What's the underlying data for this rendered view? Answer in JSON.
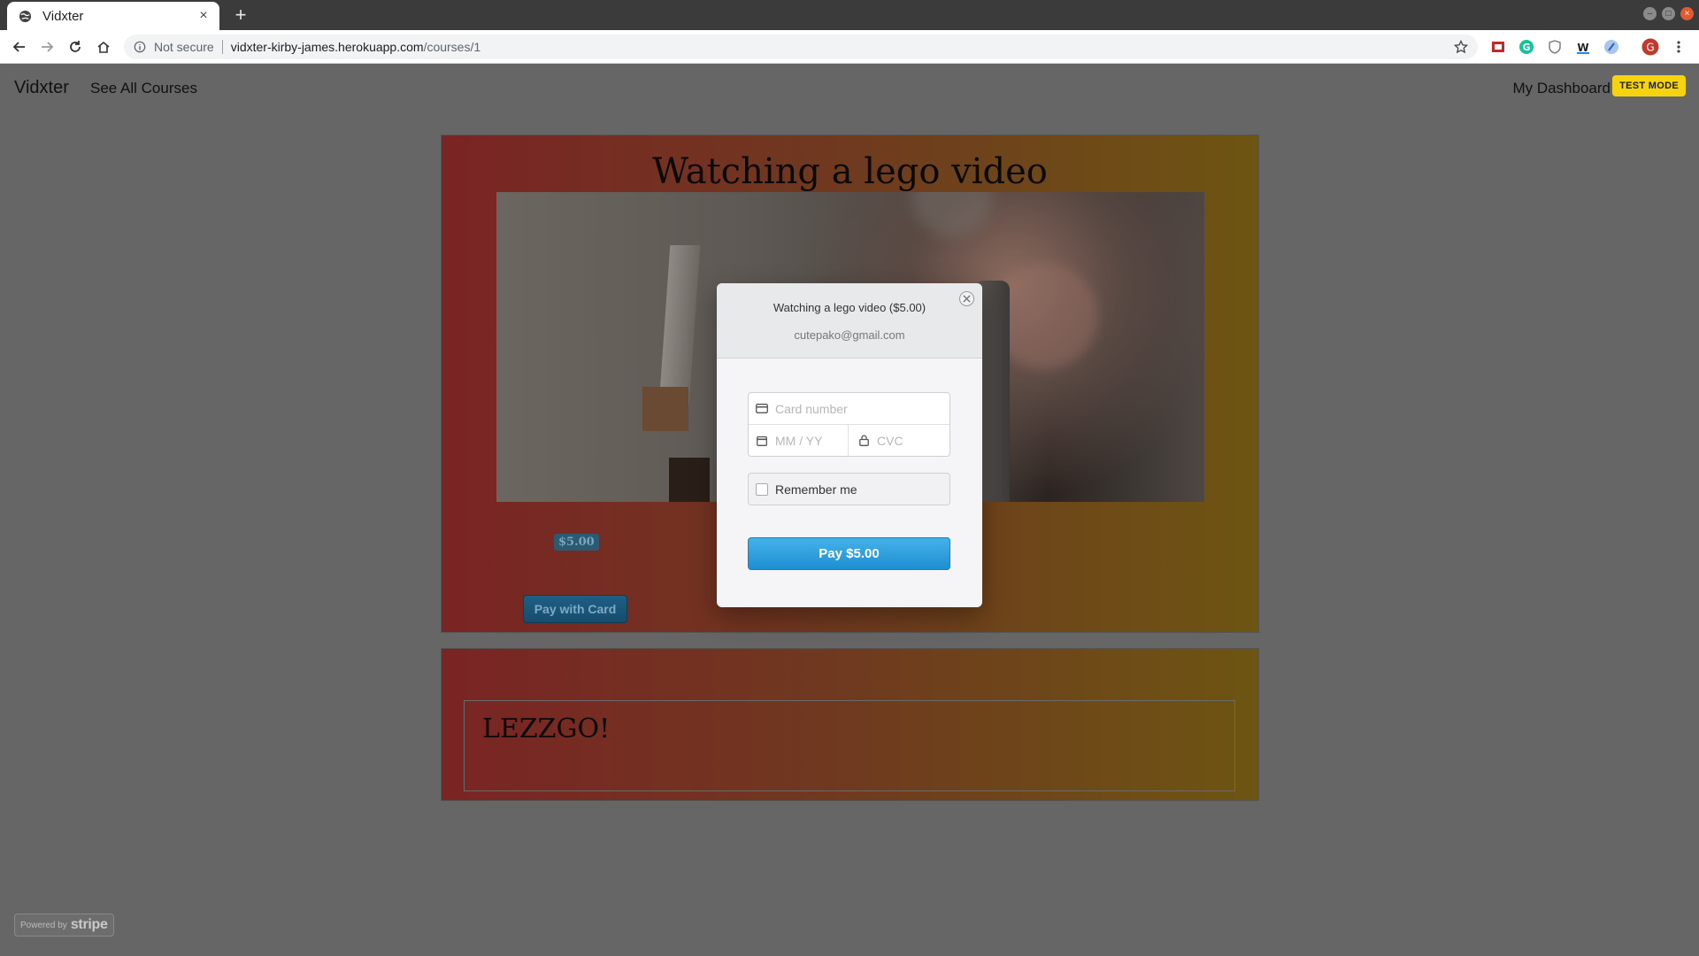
{
  "browser": {
    "tab_title": "Vidxter",
    "tab_close": "×",
    "new_tab": "+",
    "security_label": "Not secure",
    "url_host": "vidxter-kirby-james.herokuapp.com",
    "url_path": "/courses/1"
  },
  "nav": {
    "brand": "Vidxter",
    "see_all_courses": "See All Courses",
    "my_dashboard": "My Dashboard",
    "test_mode_badge": "TEST MODE"
  },
  "course": {
    "title": "Watching a lego video",
    "price": "$5.00",
    "pay_button": "Pay with Card"
  },
  "comment": {
    "text": "LEZZGO!"
  },
  "footer": {
    "powered_by": "Powered by",
    "stripe": "stripe"
  },
  "checkout": {
    "title": "Watching a lego video ($5.00)",
    "email": "cutepako@gmail.com",
    "card_number_placeholder": "Card number",
    "expiry_placeholder": "MM / YY",
    "cvc_placeholder": "CVC",
    "remember_me": "Remember me",
    "pay_button": "Pay $5.00"
  },
  "colors": {
    "pay_button": "#2d9fdf",
    "test_mode": "#f5d40f",
    "overlay": "#666666"
  },
  "icons": {
    "tab_favicon": "globe-icon",
    "back": "arrow-left-icon",
    "forward": "arrow-right-icon",
    "reload": "reload-icon",
    "home": "home-icon",
    "info": "info-icon",
    "bookmark": "star-icon",
    "menu": "kebab-menu-icon",
    "card": "credit-card-icon",
    "calendar": "calendar-icon",
    "lock": "lock-icon",
    "close": "close-icon"
  }
}
